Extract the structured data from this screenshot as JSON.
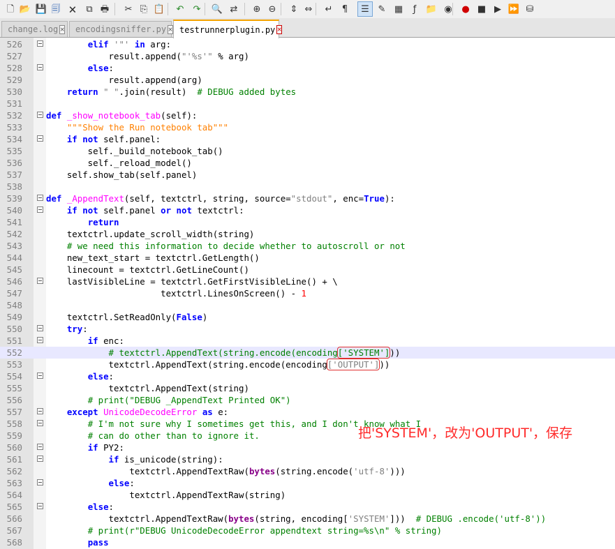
{
  "toolbar": {
    "icons": [
      "new-icon",
      "open-icon",
      "save-icon",
      "save-all-icon",
      "close-icon",
      "close-all-icon",
      "print-icon",
      "cut-icon",
      "copy-icon",
      "paste-icon",
      "undo-icon",
      "redo-icon",
      "find-icon",
      "replace-icon",
      "zoom-in-icon",
      "zoom-out-icon",
      "sync-v-icon",
      "sync-h-icon",
      "word-wrap-icon",
      "all-chars-icon",
      "indent-guide-icon",
      "udl-icon",
      "doc-map-icon",
      "function-list-icon",
      "folder-workspace-icon",
      "monitor-icon",
      "record-icon",
      "stop-icon",
      "play-icon",
      "run-multiple-icon",
      "save-macro-icon"
    ]
  },
  "tabs": [
    {
      "label": "change.log",
      "active": false
    },
    {
      "label": "encodingsniffer.py",
      "active": false
    },
    {
      "label": "testrunnerplugin.py",
      "active": true
    }
  ],
  "editor": {
    "lines": [
      {
        "n": "526",
        "fold": true
      },
      {
        "n": "527",
        "fold": false
      },
      {
        "n": "528",
        "fold": true
      },
      {
        "n": "529",
        "fold": false
      },
      {
        "n": "530",
        "fold": false
      },
      {
        "n": "531",
        "fold": false
      },
      {
        "n": "532",
        "fold": true
      },
      {
        "n": "533",
        "fold": false
      },
      {
        "n": "534",
        "fold": true
      },
      {
        "n": "535",
        "fold": false
      },
      {
        "n": "536",
        "fold": false
      },
      {
        "n": "537",
        "fold": false
      },
      {
        "n": "538",
        "fold": false
      },
      {
        "n": "539",
        "fold": true
      },
      {
        "n": "540",
        "fold": true
      },
      {
        "n": "541",
        "fold": false
      },
      {
        "n": "542",
        "fold": false
      },
      {
        "n": "543",
        "fold": false
      },
      {
        "n": "544",
        "fold": false
      },
      {
        "n": "545",
        "fold": false
      },
      {
        "n": "546",
        "fold": true
      },
      {
        "n": "547",
        "fold": false
      },
      {
        "n": "548",
        "fold": false
      },
      {
        "n": "549",
        "fold": false
      },
      {
        "n": "550",
        "fold": true
      },
      {
        "n": "551",
        "fold": true
      },
      {
        "n": "552",
        "fold": false
      },
      {
        "n": "553",
        "fold": false
      },
      {
        "n": "554",
        "fold": true
      },
      {
        "n": "555",
        "fold": false
      },
      {
        "n": "556",
        "fold": false
      },
      {
        "n": "557",
        "fold": true
      },
      {
        "n": "558",
        "fold": true
      },
      {
        "n": "559",
        "fold": false
      },
      {
        "n": "560",
        "fold": true
      },
      {
        "n": "561",
        "fold": true
      },
      {
        "n": "562",
        "fold": false
      },
      {
        "n": "563",
        "fold": true
      },
      {
        "n": "564",
        "fold": false
      },
      {
        "n": "565",
        "fold": true
      },
      {
        "n": "566",
        "fold": false
      },
      {
        "n": "567",
        "fold": false
      },
      {
        "n": "568",
        "fold": false
      }
    ],
    "highlighted_line": "552"
  },
  "code": {
    "l526": [
      "        ",
      "elif",
      " ",
      "'\"'",
      " ",
      "in",
      " arg:"
    ],
    "l527": [
      "            result.append(",
      "\"'%s'\"",
      " % arg)"
    ],
    "l528": [
      "        ",
      "else",
      ":"
    ],
    "l529": [
      "            result.append(arg)"
    ],
    "l530": [
      "    ",
      "return",
      " ",
      "\" \"",
      ".join(result)  ",
      "# DEBUG added bytes"
    ],
    "l531": [
      ""
    ],
    "l532": [
      "",
      "def",
      " ",
      "_show_notebook_tab",
      "(self):"
    ],
    "l533": [
      "    ",
      "\"\"\"Show the Run notebook tab\"\"\""
    ],
    "l534": [
      "    ",
      "if",
      " ",
      "not",
      " self.panel:"
    ],
    "l535": [
      "        self._build_notebook_tab()"
    ],
    "l536": [
      "        self._reload_model()"
    ],
    "l537": [
      "    self.show_tab(self.panel)"
    ],
    "l538": [
      ""
    ],
    "l539": [
      "",
      "def",
      " ",
      "_AppendText",
      "(self, textctrl, string, source=",
      "\"stdout\"",
      ", enc=",
      "True",
      "):"
    ],
    "l540": [
      "    ",
      "if",
      " ",
      "not",
      " self.panel ",
      "or",
      " ",
      "not",
      " textctrl:"
    ],
    "l541": [
      "        ",
      "return"
    ],
    "l542": [
      "    textctrl.update_scroll_width(string)"
    ],
    "l543": [
      "    ",
      "# we need this information to decide whether to autoscroll or not"
    ],
    "l544": [
      "    new_text_start = textctrl.GetLength()"
    ],
    "l545": [
      "    linecount = textctrl.GetLineCount()"
    ],
    "l546": [
      "    lastVisibleLine = textctrl.GetFirstVisibleLine() + \\"
    ],
    "l547": [
      "                      textctrl.LinesOnScreen() - ",
      "1"
    ],
    "l548": [
      ""
    ],
    "l549": [
      "    textctrl.SetReadOnly(",
      "False",
      ")"
    ],
    "l550": [
      "    ",
      "try",
      ":"
    ],
    "l551": [
      "        ",
      "if",
      " enc:"
    ],
    "l552": [
      "            ",
      "# textctrl.AppendText(string.encode(encoding",
      "['SYSTEM']",
      "))"
    ],
    "l553": [
      "            textctrl.AppendText(string.encode(encoding",
      "['OUTPUT']",
      "))"
    ],
    "l554": [
      "        ",
      "else",
      ":"
    ],
    "l555": [
      "            textctrl.AppendText(string)"
    ],
    "l556": [
      "        ",
      "# print(\"DEBUG _AppendText Printed OK\")"
    ],
    "l557": [
      "    ",
      "except",
      " ",
      "UnicodeDecodeError",
      " ",
      "as",
      " e:"
    ],
    "l558": [
      "        ",
      "# I'm not sure why I sometimes get this, and I don't know what I"
    ],
    "l559": [
      "        ",
      "# can do other than to ignore it."
    ],
    "l560": [
      "        ",
      "if",
      " PY2:"
    ],
    "l561": [
      "            ",
      "if",
      " is_unicode(string):"
    ],
    "l562": [
      "                textctrl.AppendTextRaw(",
      "bytes",
      "(string.encode(",
      "'utf-8'",
      ")))"
    ],
    "l563": [
      "            ",
      "else",
      ":"
    ],
    "l564": [
      "                textctrl.AppendTextRaw(string)"
    ],
    "l565": [
      "        ",
      "else",
      ":"
    ],
    "l566": [
      "            textctrl.AppendTextRaw(",
      "bytes",
      "(string, encoding[",
      "'SYSTEM'",
      "]))  ",
      "# DEBUG .encode('utf-8'))"
    ],
    "l567": [
      "        ",
      "# print(r\"DEBUG UnicodeDecodeError appendtext string=%s\\n\" % string)"
    ],
    "l568": [
      "        ",
      "pass"
    ]
  },
  "annotation": "把'SYSTEM'，改为'OUTPUT'，保存"
}
